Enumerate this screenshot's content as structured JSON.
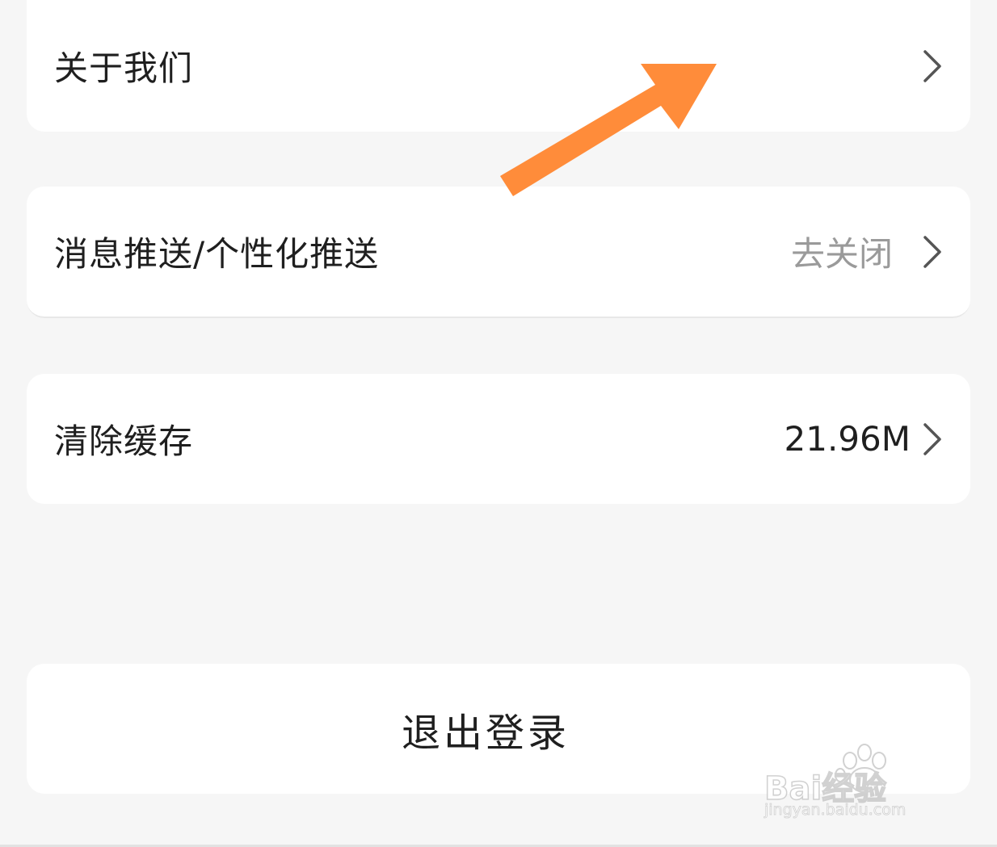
{
  "rows": {
    "about": {
      "label": "关于我们"
    },
    "push": {
      "label": "消息推送/个性化推送",
      "value": "去关闭"
    },
    "cache": {
      "label": "清除缓存",
      "value": "21.96M"
    }
  },
  "logout": {
    "label": "退出登录"
  },
  "annotation": {
    "arrow_color": "#ff8c3a"
  },
  "watermark": {
    "brand": "Bai经验",
    "url": "jingyan.baidu.com"
  },
  "icons": {
    "row_chevron": "chevron-right-icon"
  },
  "colors": {
    "background": "#f6f6f6",
    "card": "#ffffff",
    "text": "#1f1f1f",
    "muted_text": "#9a9a9a"
  }
}
